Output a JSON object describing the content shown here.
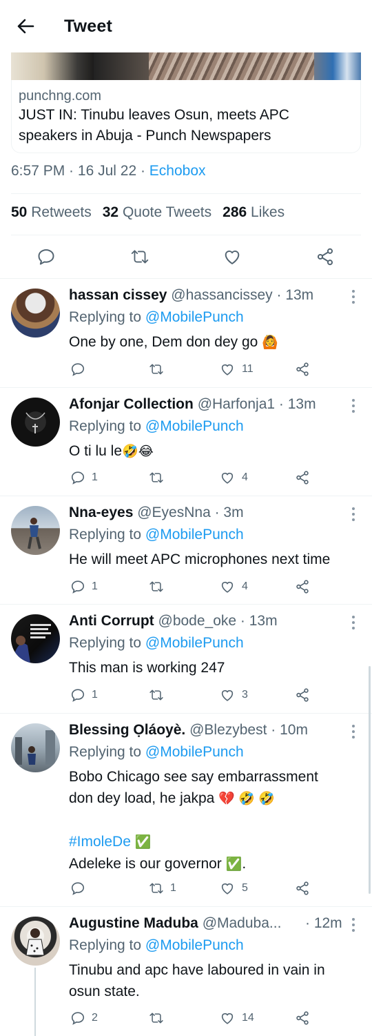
{
  "header": {
    "title": "Tweet"
  },
  "link_card": {
    "domain": "punchng.com",
    "headline_line1": "JUST IN: Tinubu leaves Osun, meets APC",
    "headline_line2": "speakers in Abuja - Punch Newspapers"
  },
  "meta": {
    "time": "6:57 PM",
    "sep1": " · ",
    "date": "16 Jul 22",
    "sep2": " · ",
    "source": "Echobox"
  },
  "stats": {
    "retweets_count": "50",
    "retweets_label": "Retweets",
    "quotes_count": "32",
    "quotes_label": "Quote Tweets",
    "likes_count": "286",
    "likes_label": "Likes"
  },
  "replies": [
    {
      "name": "hassan cissey",
      "handle": "@hassancissey · 13m",
      "replying_prefix": "Replying to ",
      "replying_to": "@MobilePunch",
      "text": "One by one, Dem don dey go",
      "emoji": "🙆",
      "reply_count": "",
      "retweet_count": "",
      "like_count": "11"
    },
    {
      "name": "Afonjar Collection",
      "handle": "@Harfonja1 · 13m",
      "replying_prefix": "Replying to ",
      "replying_to": "@MobilePunch",
      "text": "O ti lu le",
      "emoji": "🤣😂",
      "reply_count": "1",
      "retweet_count": "",
      "like_count": "4"
    },
    {
      "name": "Nna-eyes",
      "handle": "@EyesNna · 3m",
      "replying_prefix": "Replying to ",
      "replying_to": "@MobilePunch",
      "text": "He will meet APC microphones next time",
      "emoji": "",
      "reply_count": "1",
      "retweet_count": "",
      "like_count": "4"
    },
    {
      "name": "Anti Corrupt",
      "handle": "@bode_oke · 13m",
      "replying_prefix": "Replying to ",
      "replying_to": "@MobilePunch",
      "text": "This man is working 247",
      "emoji": "",
      "reply_count": "1",
      "retweet_count": "",
      "like_count": "3"
    },
    {
      "name": "Blessing Ọláoyè.",
      "handle": "@Blezybest · 10m",
      "replying_prefix": "Replying to ",
      "replying_to": "@MobilePunch",
      "text_line1": "Bobo Chicago see say embarrassment",
      "text_line2": "don dey load, he jakpa",
      "emoji_line2": "💔 🤣 🤣",
      "hashtag": "#ImoleDe",
      "hashtag_emoji": "✅",
      "text_line4": "Adeleke is our governor",
      "emoji_line4": "✅",
      "text_line4_end": ".",
      "reply_count": "",
      "retweet_count": "1",
      "like_count": "5"
    },
    {
      "name": "Augustine Maduba",
      "handle": "@Maduba...",
      "time": " · 12m",
      "replying_prefix": "Replying to ",
      "replying_to": "@MobilePunch",
      "text_line1": "Tinubu and apc have laboured in vain in",
      "text_line2": "osun state.",
      "reply_count": "2",
      "retweet_count": "",
      "like_count": "14"
    }
  ],
  "colors": {
    "accent": "#1d9bf0",
    "text": "#0f1419",
    "muted": "#536471",
    "divider": "#eff3f4"
  }
}
